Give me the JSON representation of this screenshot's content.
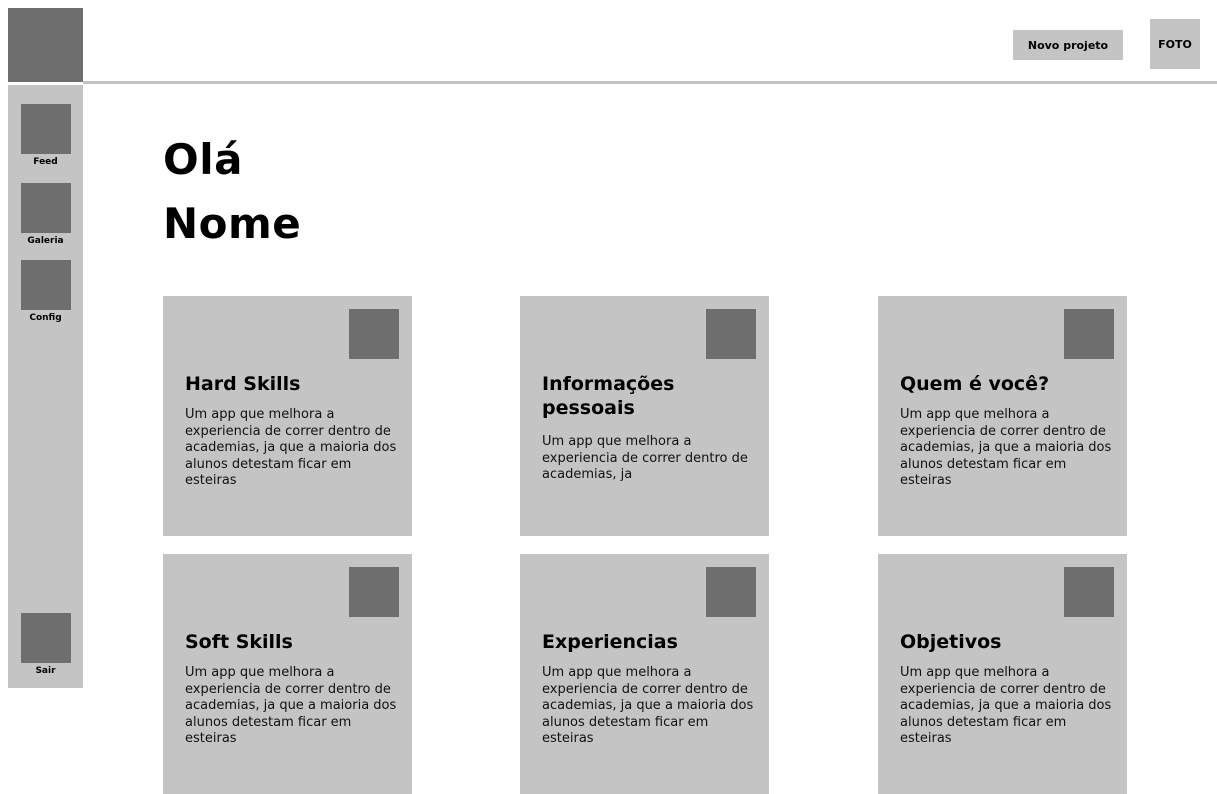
{
  "header": {
    "new_project_label": "Novo projeto",
    "photo_label": "FOTO"
  },
  "sidebar": {
    "items": [
      {
        "label": "Feed",
        "icon": "feed-icon"
      },
      {
        "label": "Galeria",
        "icon": "gallery-icon"
      },
      {
        "label": "Config",
        "icon": "settings-icon"
      }
    ],
    "logout": {
      "label": "Sair",
      "icon": "logout-icon"
    }
  },
  "main": {
    "greeting_line1": "Olá",
    "greeting_line2": "Nome",
    "cards": [
      {
        "title": "Hard Skills",
        "description": "Um app que melhora a experiencia de correr dentro de academias, ja que a maioria dos alunos detestam ficar em esteiras"
      },
      {
        "title": "Informações pessoais",
        "description": "Um app que melhora a experiencia de correr dentro de academias, ja"
      },
      {
        "title": "Quem é você?",
        "description": "Um app que melhora a experiencia de correr dentro de academias, ja que a maioria dos alunos detestam ficar em esteiras"
      },
      {
        "title": "Soft Skills",
        "description": "Um app que melhora a experiencia de correr dentro de academias, ja que a maioria dos alunos detestam ficar em esteiras"
      },
      {
        "title": "Experiencias",
        "description": "Um app que melhora a experiencia de correr dentro de academias, ja que a maioria dos alunos detestam ficar em esteiras"
      },
      {
        "title": "Objetivos",
        "description": "Um app que melhora a experiencia de correr dentro de academias, ja que a maioria dos alunos detestam ficar em esteiras"
      }
    ]
  },
  "colors": {
    "placeholder_dark": "#6e6e6e",
    "placeholder_light": "#c4c4c4",
    "background": "#ffffff",
    "text": "#000000"
  }
}
